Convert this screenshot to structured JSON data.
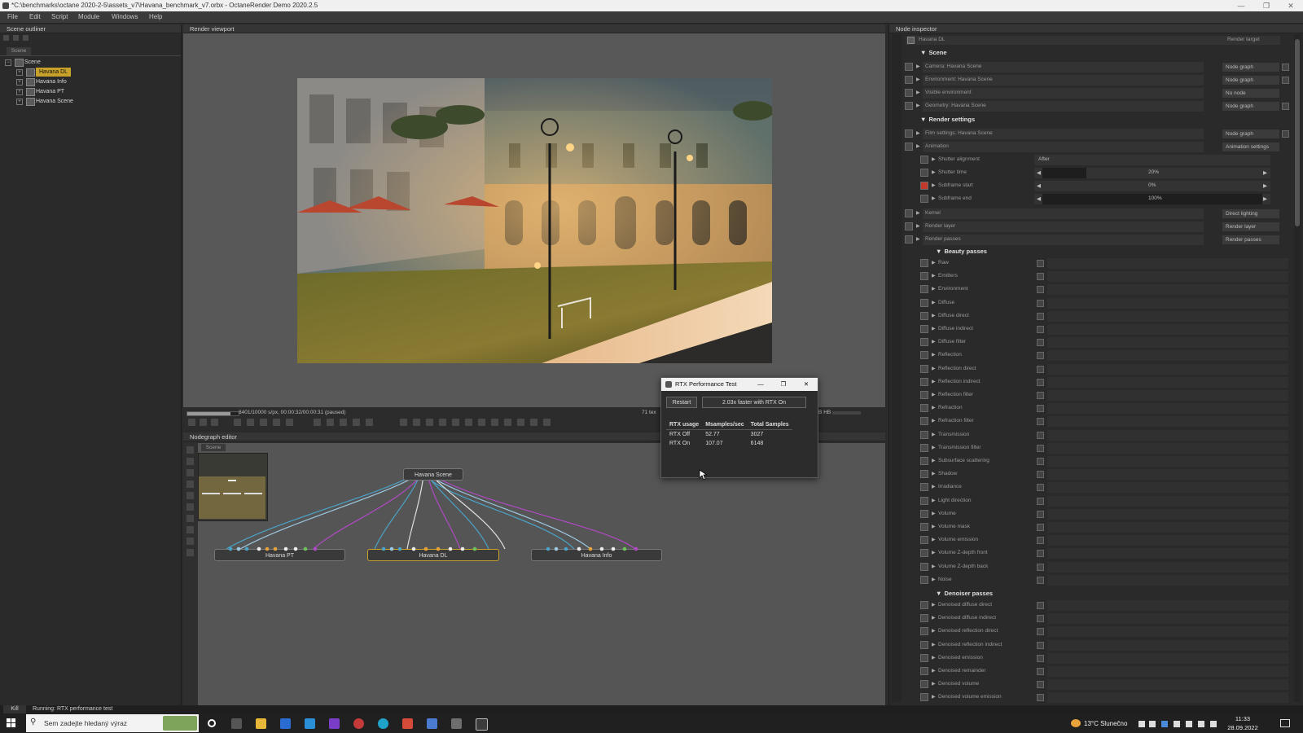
{
  "window": {
    "title": "*C:\\benchmarks\\octane 2020-2-5\\assets_v7\\Havana_benchmark_v7.orbx - OctaneRender Demo 2020.2.5",
    "minimize": "—",
    "maximize": "❐",
    "close": "✕"
  },
  "menu": [
    "File",
    "Edit",
    "Script",
    "Module",
    "Windows",
    "Help"
  ],
  "outliner": {
    "title": "Scene outliner",
    "tab": "Scene",
    "root": "Scene",
    "items": [
      "Havana DL",
      "Havana Info",
      "Havana PT",
      "Havana Scene"
    ]
  },
  "viewport": {
    "title": "Render viewport",
    "progress_text": "8401/10000 s/px, 00:00:32/00:00:31 (paused)",
    "progress_fraction": 0.84,
    "tri_text": "71 tex",
    "mem_text": "GB HB"
  },
  "nodegraph": {
    "title": "Nodegraph editor",
    "tab": "Scene",
    "nodes": {
      "scene": "Havana Scene",
      "pt": "Havana PT",
      "dl": "Havana DL",
      "info": "Havana Info"
    }
  },
  "dialog": {
    "title": "RTX Performance Test",
    "restart": "Restart",
    "result": "2.03x faster with RTX On",
    "columns": [
      "RTX usage",
      "Msamples/sec",
      "Total Samples"
    ],
    "rows": [
      [
        "RTX Off",
        "52.77",
        "3027"
      ],
      [
        "RTX On",
        "107.07",
        "6148"
      ]
    ]
  },
  "inspector": {
    "title": "Node inspector",
    "node": "Havana DL",
    "node_target": "Render target",
    "scene_header": "Scene",
    "scene_rows": [
      {
        "label": "Camera: Havana Scene",
        "btn": "Node graph"
      },
      {
        "label": "Environment: Havana Scene",
        "btn": "Node graph"
      },
      {
        "label": "Visible environment",
        "btn": "No node"
      },
      {
        "label": "Geometry: Havana Scene",
        "btn": "Node graph"
      }
    ],
    "render_header": "Render settings",
    "film": {
      "label": "Film settings: Havana Scene",
      "btn": "Node graph"
    },
    "animation": {
      "label": "Animation",
      "btn": "Animation settings"
    },
    "anim_rows": [
      {
        "label": "Shutter alignment",
        "value": "After"
      },
      {
        "label": "Shutter time",
        "value": "20%",
        "fraction": 0.2
      },
      {
        "label": "Subframe start",
        "value": "0%",
        "fraction": 0.0
      },
      {
        "label": "Subframe end",
        "value": "100%",
        "fraction": 1.0
      }
    ],
    "kernel": {
      "label": "Kernel",
      "btn": "Direct lighting"
    },
    "render_layer": {
      "label": "Render layer",
      "btn": "Render layer"
    },
    "render_passes": {
      "label": "Render passes",
      "btn": "Render passes"
    },
    "beauty_header": "Beauty passes",
    "beauty": [
      "Raw",
      "Emitters",
      "Environment",
      "Diffuse",
      "Diffuse direct",
      "Diffuse indirect",
      "Diffuse filter",
      "Reflection",
      "Reflection direct",
      "Reflection indirect",
      "Reflection filter",
      "Refraction",
      "Refraction filter",
      "Transmission",
      "Transmission filter",
      "Subsurface scattering",
      "Shadow",
      "Irradiance",
      "Light direction",
      "Volume",
      "Volume mask",
      "Volume emission",
      "Volume Z-depth front",
      "Volume Z-depth back",
      "Noise"
    ],
    "denoiser_header": "Denoiser passes",
    "denoiser": [
      "Denoised diffuse direct",
      "Denoised diffuse indirect",
      "Denoised reflection direct",
      "Denoised reflection indirect",
      "Denoised emission",
      "Denoised remainder",
      "Denoised volume",
      "Denoised volume emission"
    ]
  },
  "statusbar": {
    "kill": "Kill",
    "text": "Running: RTX performance test"
  },
  "taskbar": {
    "search_placeholder": "Sem zadejte hledaný výraz",
    "weather": "13°C  Slunečno",
    "time": "11:33",
    "date": "28.09.2022"
  },
  "colors": {
    "selected": "#c8a12a",
    "accent_red": "#c23a2b",
    "taskbar": "#202020"
  }
}
